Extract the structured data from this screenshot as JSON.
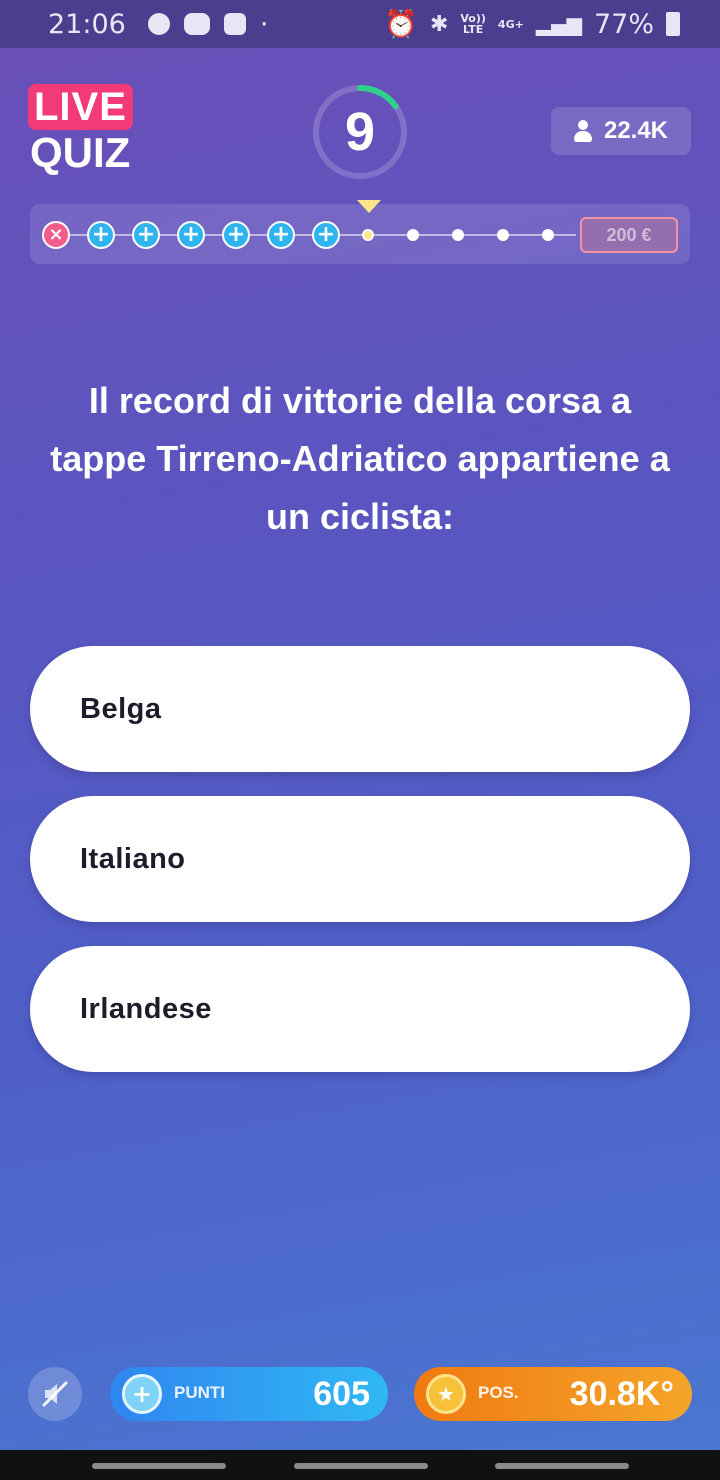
{
  "status_bar": {
    "time": "21:06",
    "battery": "77%",
    "volte_line1": "Vo))",
    "volte_line2": "LTE",
    "network": "4G+"
  },
  "header": {
    "logo_live": "LIVE",
    "logo_quiz": "QUIZ",
    "timer_value": "9",
    "timer_progress": 0.15,
    "viewers": "22.4K"
  },
  "progress": {
    "prize": "200 €",
    "completed_plus_nodes": 6,
    "remaining_dots": 5
  },
  "question": {
    "text": "Il record di vittorie della corsa a tappe Tirreno-Adriatico appartiene a un ciclista:"
  },
  "answers": [
    {
      "label": "Belga"
    },
    {
      "label": "Italiano"
    },
    {
      "label": "Irlandese"
    }
  ],
  "footer": {
    "points_label": "PUNTI",
    "points_value": "605",
    "position_label": "POS.",
    "position_value": "30.8K°"
  },
  "colors": {
    "accent_pink": "#f23a78",
    "timer_green": "#2ed08a",
    "points_blue": "#2f86f0",
    "position_orange": "#f07a10"
  },
  "icons": [
    "game-controller-icon",
    "discord-icon",
    "checkbox-icon",
    "alarm-icon",
    "bluetooth-icon",
    "signal-icon",
    "battery-icon",
    "person-icon",
    "close-icon",
    "plus-icon",
    "mute-icon",
    "star-medal-icon"
  ]
}
